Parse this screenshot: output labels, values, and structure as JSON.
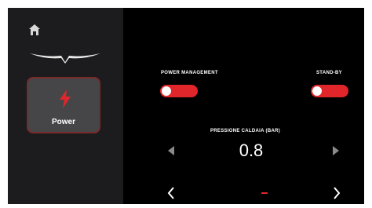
{
  "sidebar": {
    "home_icon": "home-icon",
    "logo": "winged-logo",
    "power_tile": {
      "label": "Power",
      "icon": "lightning-bolt-icon"
    }
  },
  "power_management": {
    "label": "POWER MANAGEMENT",
    "state": "off"
  },
  "stand_by": {
    "label": "STAND-BY",
    "state": "off"
  },
  "pressure": {
    "label": "PRESSIONE CALDAIA (bar)",
    "value": "0.8"
  },
  "pager": {
    "prev_icon": "chevron-left-icon",
    "next_icon": "chevron-right-icon",
    "indicator": "page-indicator"
  },
  "colors": {
    "accent": "#e0262a",
    "sidebar_bg": "#1c1c1e",
    "tile_bg": "#464648",
    "screen_bg": "#000000"
  }
}
